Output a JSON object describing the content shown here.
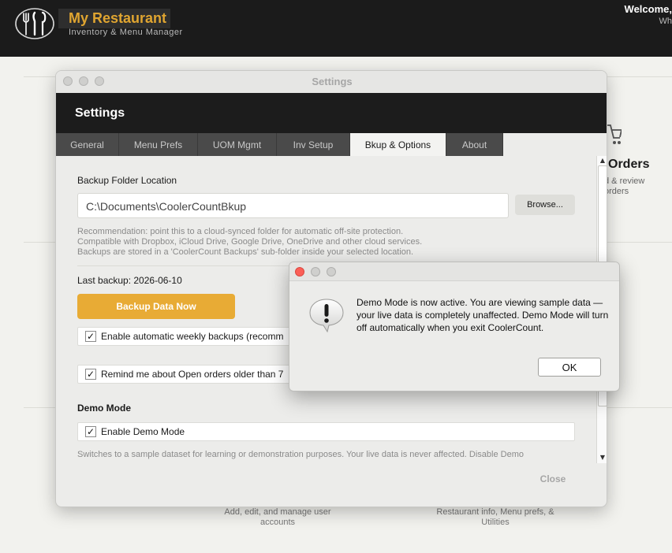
{
  "app": {
    "title": "My Restaurant",
    "subtitle": "Inventory & Menu Manager",
    "welcome": "Welcome,",
    "welcome_sub": "Wh",
    "logo_icon": "fork-knife-spoon-plate-icon"
  },
  "dashboard": {
    "orders": {
      "title": "Orders",
      "description": "d & review\norders",
      "icon": "shopping-cart-icon"
    },
    "users_description": "Add, edit, and manage user accounts",
    "info_description": "Restaurant info, Menu prefs, & Utilities"
  },
  "settings_window": {
    "window_title": "Settings",
    "header_title": "Settings",
    "tabs": [
      {
        "label": "General",
        "active": false
      },
      {
        "label": "Menu Prefs",
        "active": false
      },
      {
        "label": "UOM Mgmt",
        "active": false
      },
      {
        "label": "Inv Setup",
        "active": false
      },
      {
        "label": "Bkup & Options",
        "active": true
      },
      {
        "label": "About",
        "active": false
      }
    ],
    "backup_folder_label": "Backup Folder Location",
    "backup_folder_value": "C:\\Documents\\CoolerCountBkup",
    "browse_label": "Browse...",
    "recommendation": [
      "Recommendation: point this to a cloud-synced folder for automatic off-site protection.",
      "Compatible with Dropbox, iCloud Drive, Google Drive, OneDrive and other cloud services.",
      "Backups are stored in a 'CoolerCount Backups' sub-folder inside your selected location."
    ],
    "last_backup": "Last backup: 2026-06-10",
    "backup_now_label": "Backup Data Now",
    "auto_backup_label": "Enable automatic weekly backups (recomm",
    "auto_backup_checked": true,
    "remind_label": "Remind me about Open orders older than 7",
    "remind_checked": true,
    "demo_heading": "Demo Mode",
    "demo_checkbox_label": "Enable Demo Mode",
    "demo_checked": true,
    "demo_description": "Switches to a sample dataset for learning or demonstration purposes. Your live data is never affected. Disable Demo",
    "close_label": "Close",
    "check_mark": "✓",
    "scroll_up_glyph": "▲",
    "scroll_down_glyph": "▼"
  },
  "alert": {
    "icon": "speech-bubble-exclamation-icon",
    "message": "Demo Mode is now active. You are viewing sample data — your live data is completely unaffected. Demo Mode will turn off automatically when you exit CoolerCount.",
    "ok_label": "OK"
  },
  "colors": {
    "brand": "#e0a530",
    "backup_button": "#e8ab35",
    "header": "#1c1c1c",
    "close_red": "#fb5f57"
  }
}
